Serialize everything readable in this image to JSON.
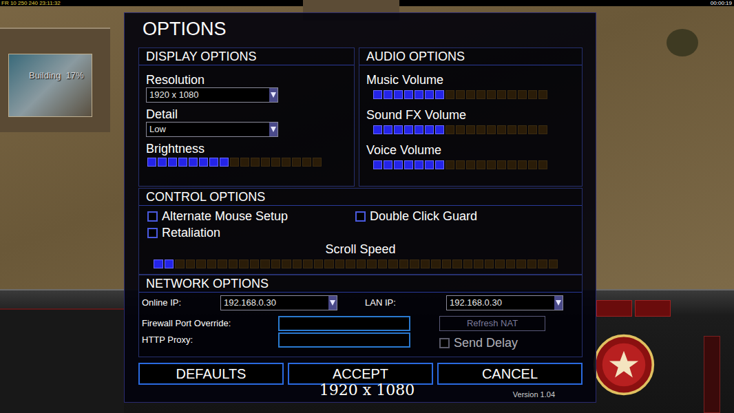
{
  "hud": {
    "stats": "FR 10 250 240 23:11:32",
    "timer": "00:00:19"
  },
  "game": {
    "building_status": "Building  17%"
  },
  "dialog": {
    "title": "OPTIONS",
    "display": {
      "heading": "DISPLAY OPTIONS",
      "fields": [
        {
          "label": "Resolution",
          "value": "1920 x 1080"
        },
        {
          "label": "Detail",
          "value": "Low"
        }
      ],
      "brightness": {
        "label": "Brightness",
        "level": 0.47
      }
    },
    "audio": {
      "heading": "AUDIO OPTIONS",
      "sliders": [
        {
          "label": "Music Volume",
          "level": 0.41
        },
        {
          "label": "Sound FX Volume",
          "level": 0.41
        },
        {
          "label": "Voice Volume",
          "level": 0.41
        }
      ]
    },
    "controls": {
      "heading": "CONTROL OPTIONS",
      "checkboxes": [
        {
          "label": "Alternate Mouse Setup",
          "checked": false
        },
        {
          "label": "Double Click Guard",
          "checked": false
        },
        {
          "label": "Retaliation",
          "checked": false
        }
      ],
      "scroll_speed": {
        "label": "Scroll Speed",
        "level": 0.05
      }
    },
    "network": {
      "heading": "NETWORK OPTIONS",
      "ip_fields": [
        {
          "label": "Online IP:",
          "value": "192.168.0.30"
        },
        {
          "label": "LAN IP:",
          "value": "192.168.0.30"
        }
      ],
      "text_fields": [
        {
          "label": "Firewall Port Override:"
        },
        {
          "label": "HTTP Proxy:"
        }
      ],
      "refresh_button": {
        "label": "Refresh NAT",
        "disabled": true
      },
      "send_delay": {
        "label": "Send Delay",
        "checked": false,
        "disabled": true
      }
    },
    "buttons": [
      "DEFAULTS",
      "ACCEPT",
      "CANCEL"
    ],
    "version": "Version 1.04"
  },
  "overlay_text": "1920 x 1080"
}
